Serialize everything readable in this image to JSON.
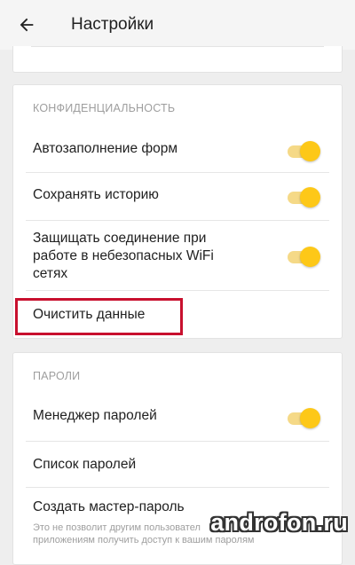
{
  "appbar": {
    "title": "Настройки",
    "back_icon": "arrow-left-icon"
  },
  "privacy": {
    "header": "КОНФИДЕНЦИАЛЬНОСТЬ",
    "autofill": {
      "label": "Автозаполнение форм",
      "enabled": true
    },
    "history": {
      "label": "Сохранять историю",
      "enabled": true
    },
    "wifi": {
      "label": "Защищать соединение при\nработе в небезопасных WiFi\nсетях",
      "enabled": true
    },
    "clear_data": {
      "label": "Очистить данные"
    }
  },
  "passwords": {
    "header": "ПАРОЛИ",
    "manager": {
      "label": "Менеджер паролей",
      "enabled": true
    },
    "list": {
      "label": "Список паролей"
    },
    "master": {
      "label": "Создать мастер-пароль",
      "note": "Это не позволит другим пользовател\nприложениям получить доступ к вашим паролям"
    }
  },
  "colors": {
    "switch_thumb": "#fdc818",
    "switch_track": "#f5d987",
    "highlight": "#c8102e"
  },
  "watermark": "androfon.ru"
}
